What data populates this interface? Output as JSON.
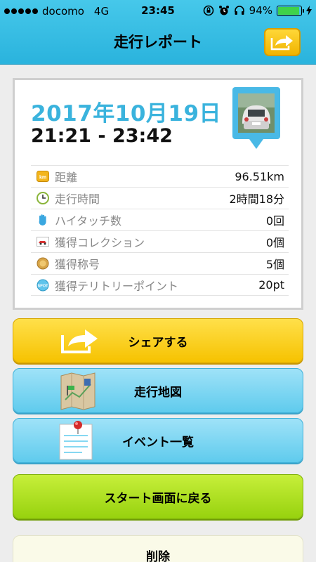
{
  "status_bar": {
    "carrier": "docomo",
    "network": "4G",
    "time": "23:45",
    "battery_percent": "94%",
    "battery_level": 0.94
  },
  "header": {
    "title": "走行レポート",
    "share_icon": "share-arrow-icon"
  },
  "report": {
    "date": "2017年10月19日",
    "time_range": "21:21 - 23:42",
    "rows": [
      {
        "icon": "km-icon",
        "label": "距離",
        "value": "96.51km"
      },
      {
        "icon": "clock-icon",
        "label": "走行時間",
        "value": "2時間18分"
      },
      {
        "icon": "hand-icon",
        "label": "ハイタッチ数",
        "value": "0回"
      },
      {
        "icon": "car-collection-icon",
        "label": "獲得コレクション",
        "value": "0個"
      },
      {
        "icon": "medal-icon",
        "label": "獲得称号",
        "value": "5個"
      },
      {
        "icon": "spot-icon",
        "label": "獲得テリトリーポイント",
        "value": "20pt"
      }
    ]
  },
  "buttons": {
    "share": "シェアする",
    "map": "走行地図",
    "events": "イベント一覧",
    "back": "スタート画面に戻る",
    "delete": "削除"
  },
  "colors": {
    "header": "#2ab3dd",
    "date_text": "#3ab3dd",
    "share_button": "#f6c200",
    "blue_button": "#5fcbed",
    "green_button": "#97d20e"
  }
}
